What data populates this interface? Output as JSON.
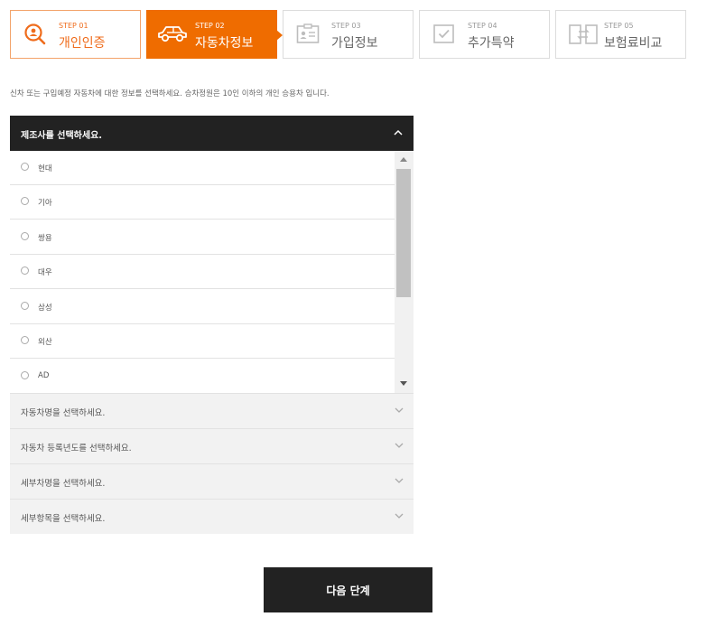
{
  "steps": [
    {
      "num": "STEP 01",
      "label": "개인인증",
      "icon": "search-person-icon",
      "state": "completed"
    },
    {
      "num": "STEP 02",
      "label": "자동차정보",
      "icon": "car-icon",
      "state": "active"
    },
    {
      "num": "STEP 03",
      "label": "가입정보",
      "icon": "id-card-icon",
      "state": "pending"
    },
    {
      "num": "STEP 04",
      "label": "추가특약",
      "icon": "checkbox-icon",
      "state": "pending"
    },
    {
      "num": "STEP 05",
      "label": "보험료비교",
      "icon": "compare-icon",
      "state": "pending"
    }
  ],
  "instruction": "신차 또는 구입예정 자동차에 대한 정보를 선택하세요. 승차정원은 10인 이하의 개인 승용차 입니다.",
  "manufacturer": {
    "title": "제조사를 선택하세요.",
    "options": [
      "현대",
      "기아",
      "쌍용",
      "대우",
      "삼성",
      "외산",
      "AD"
    ]
  },
  "sections": [
    "자동차명을 선택하세요.",
    "자동차 등록년도를 선택하세요.",
    "세부차명을 선택하세요.",
    "세부항목을 선택하세요."
  ],
  "next_button": "다음 단계",
  "colors": {
    "accent": "#ef6c00",
    "dark": "#222222"
  }
}
